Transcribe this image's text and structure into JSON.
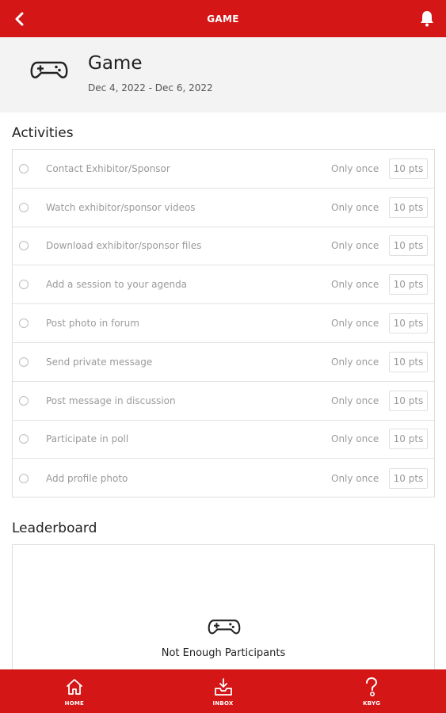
{
  "topbar": {
    "title": "GAME",
    "back_icon": "back-arrow-icon",
    "bell_icon": "bell-icon",
    "color": "#d41616"
  },
  "header": {
    "title": "Game",
    "dates": "Dec 4, 2022 - Dec 6, 2022",
    "icon": "gamepad-icon"
  },
  "activities": {
    "heading": "Activities",
    "items": [
      {
        "label": "Contact Exhibitor/Sponsor",
        "frequency": "Only once",
        "points": "10 pts"
      },
      {
        "label": "Watch exhibitor/sponsor videos",
        "frequency": "Only once",
        "points": "10 pts"
      },
      {
        "label": "Download exhibitor/sponsor files",
        "frequency": "Only once",
        "points": "10 pts"
      },
      {
        "label": "Add a session to your agenda",
        "frequency": "Only once",
        "points": "10 pts"
      },
      {
        "label": "Post photo in forum",
        "frequency": "Only once",
        "points": "10 pts"
      },
      {
        "label": "Send private message",
        "frequency": "Only once",
        "points": "10 pts"
      },
      {
        "label": "Post message in discussion",
        "frequency": "Only once",
        "points": "10 pts"
      },
      {
        "label": "Participate in poll",
        "frequency": "Only once",
        "points": "10 pts"
      },
      {
        "label": "Add profile photo",
        "frequency": "Only once",
        "points": "10 pts"
      }
    ]
  },
  "leaderboard": {
    "heading": "Leaderboard",
    "empty_title": "Not Enough Participants",
    "empty_subtitle": ""
  },
  "bottom_nav": {
    "items": [
      {
        "label": "HOME",
        "icon": "home-icon"
      },
      {
        "label": "INBOX",
        "icon": "inbox-icon"
      },
      {
        "label": "KBYG",
        "icon": "question-icon"
      }
    ]
  }
}
